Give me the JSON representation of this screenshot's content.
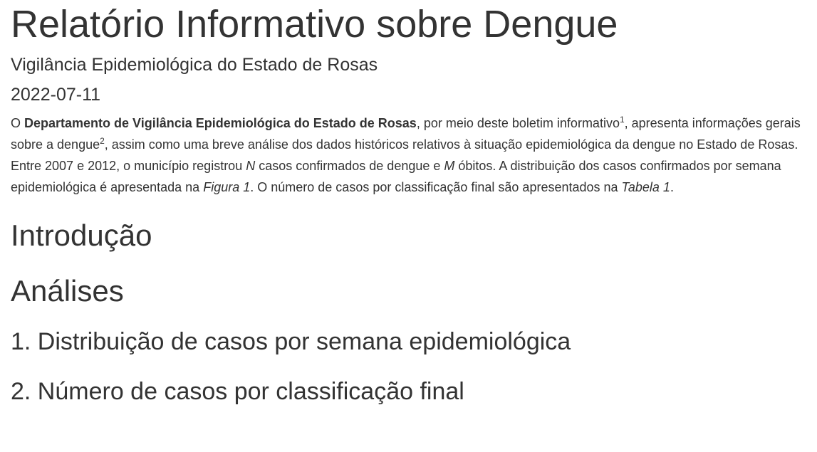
{
  "document": {
    "title": "Relatório Informativo sobre Dengue",
    "subtitle": "Vigilância Epidemiológica do Estado de Rosas",
    "date": "2022-07-11"
  },
  "intro": {
    "t1": "O ",
    "b1": "Departamento de Vigilância Epidemiológica do Estado de Rosas",
    "t2": ", por meio deste boletim informativo",
    "sup1": "1",
    "t3": ", apresenta informações gerais sobre a dengue",
    "sup2": "2",
    "t4": ", assim como uma breve análise dos dados históricos relativos à situação epidemiológica da dengue no Estado de Rosas. Entre 2007 e 2012, o município registrou ",
    "i1": "N",
    "t5": " casos confirmados de dengue e ",
    "i2": "M",
    "t6": " óbitos. A distribuição dos casos confirmados por semana epidemiológica é apresentada na ",
    "i3": "Figura 1",
    "t7": ". O número de casos por classificação final são apresentados na ",
    "i4": "Tabela 1",
    "t8": "."
  },
  "sections": {
    "introducao": "Introdução",
    "analises": "Análises",
    "sub1": "1. Distribuição de casos por semana epidemiológica",
    "sub2": "2. Número de casos por classificação final"
  }
}
